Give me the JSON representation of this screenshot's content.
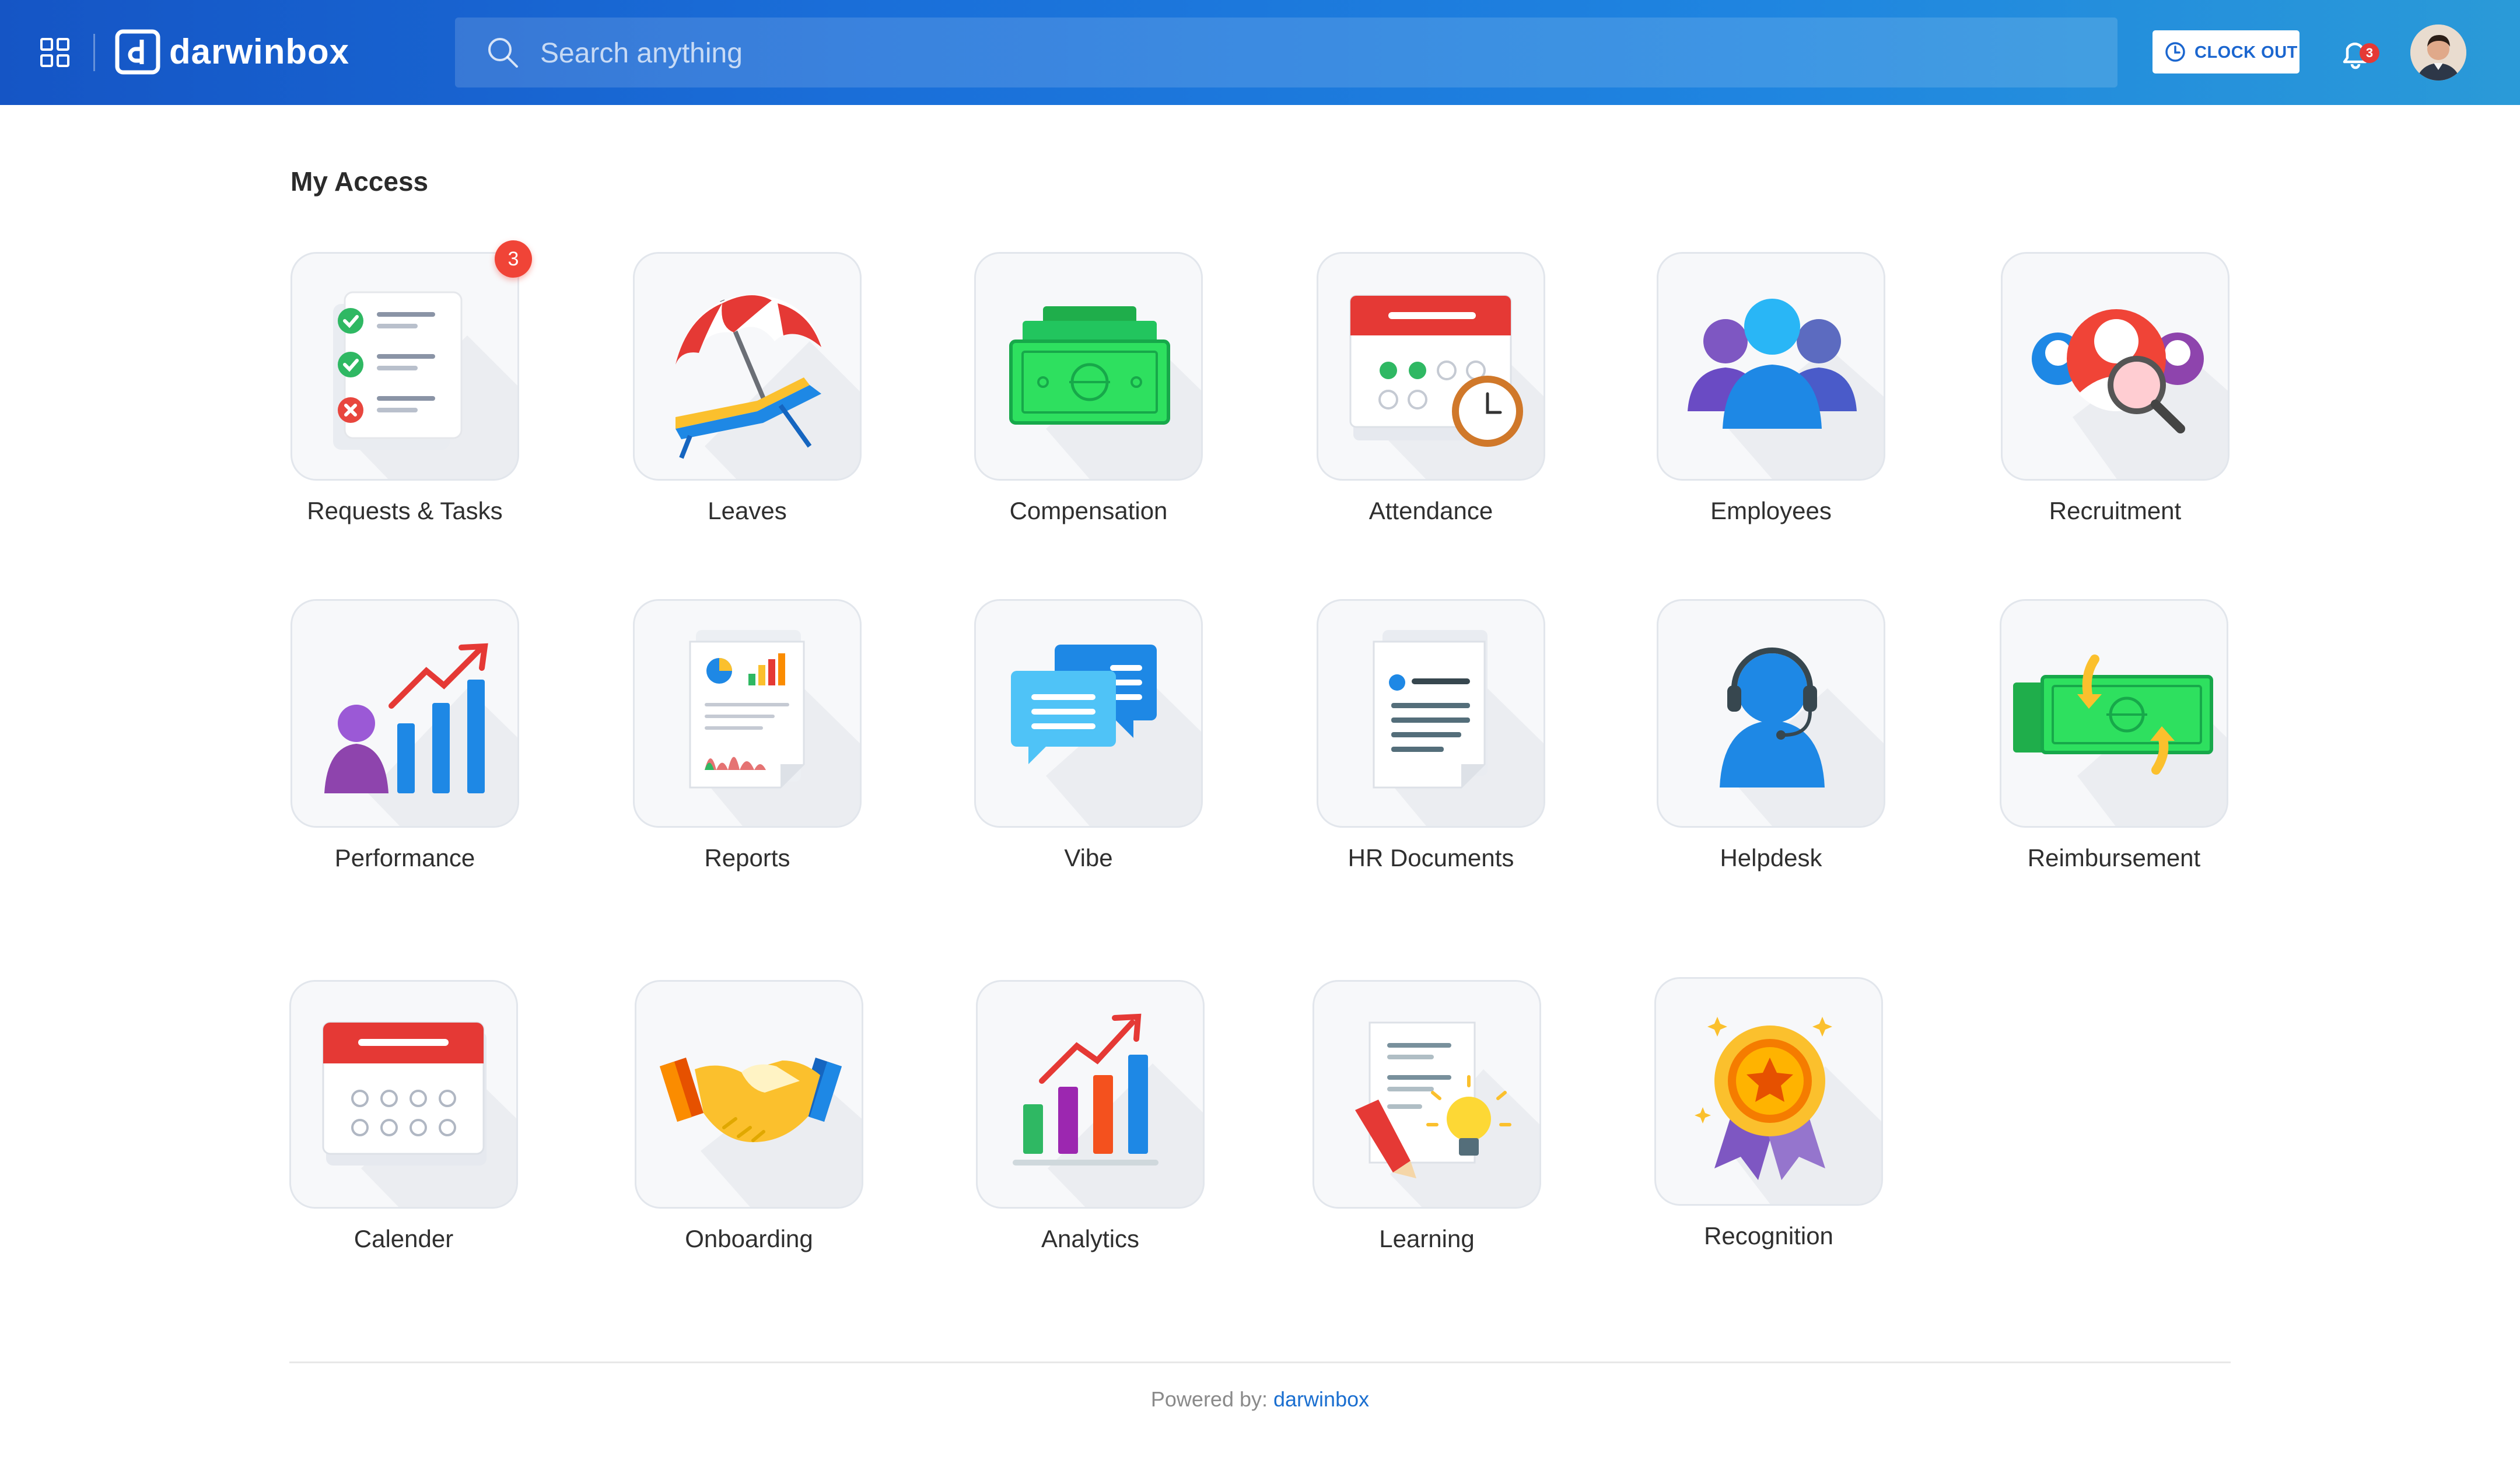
{
  "header": {
    "brand": "darwinbox",
    "search_placeholder": "Search anything",
    "clock_out_label": "CLOCK OUT",
    "notification_count": "3"
  },
  "main": {
    "title": "My Access",
    "tiles": [
      {
        "label": "Requests & Tasks",
        "icon": "requests-tasks-icon",
        "badge": "3"
      },
      {
        "label": "Leaves",
        "icon": "beach-chair-icon"
      },
      {
        "label": "Compensation",
        "icon": "cash-stack-icon"
      },
      {
        "label": "Attendance",
        "icon": "calendar-clock-icon"
      },
      {
        "label": "Employees",
        "icon": "people-group-icon"
      },
      {
        "label": "Recruitment",
        "icon": "candidate-search-icon"
      },
      {
        "label": "Performance",
        "icon": "growth-chart-icon"
      },
      {
        "label": "Reports",
        "icon": "report-document-icon"
      },
      {
        "label": "Vibe",
        "icon": "chat-bubbles-icon"
      },
      {
        "label": "HR Documents",
        "icon": "documents-icon"
      },
      {
        "label": "Helpdesk",
        "icon": "support-headset-icon"
      },
      {
        "label": "Reimbursement",
        "icon": "cash-exchange-icon"
      },
      {
        "label": "Calender",
        "icon": "calendar-icon"
      },
      {
        "label": "Onboarding",
        "icon": "handshake-icon"
      },
      {
        "label": "Analytics",
        "icon": "bar-chart-icon"
      },
      {
        "label": "Learning",
        "icon": "lightbulb-document-icon"
      },
      {
        "label": "Recognition",
        "icon": "award-badge-icon"
      }
    ]
  },
  "footer": {
    "powered_by": "Powered by: ",
    "brand": "darwinbox"
  },
  "colors": {
    "header_start": "#1555c5",
    "header_end": "#2a9ad8",
    "badge_red": "#f04437",
    "link_blue": "#1b6fd0"
  }
}
